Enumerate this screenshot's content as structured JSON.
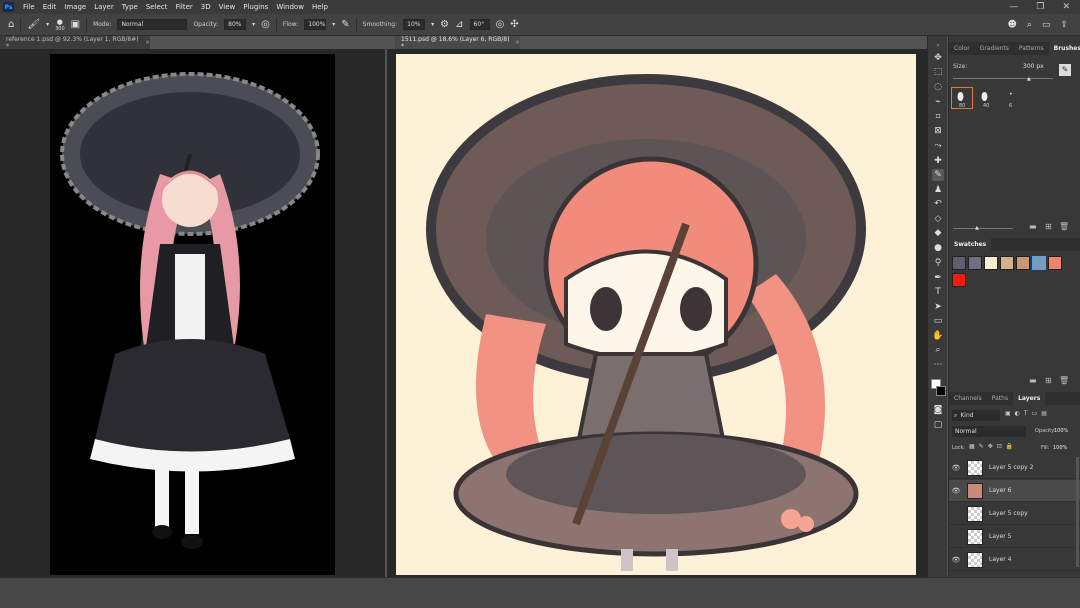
{
  "menubar": {
    "logo": "Ps",
    "items": [
      "File",
      "Edit",
      "Image",
      "Layer",
      "Type",
      "Select",
      "Filter",
      "3D",
      "View",
      "Plugins",
      "Window",
      "Help"
    ],
    "window_controls": [
      "—",
      "❐",
      "✕"
    ]
  },
  "options_bar": {
    "brush_size": "300",
    "mode_label": "Mode:",
    "mode_value": "Normal",
    "opacity_label": "Opacity:",
    "opacity_value": "80%",
    "flow_label": "Flow:",
    "flow_value": "100%",
    "smoothing_label": "Smoothing:",
    "smoothing_value": "10%",
    "angle_value": "60°"
  },
  "documents": [
    {
      "tab_label": "reference 1.psd @ 92.3% (Layer 1, RGB/8#) *"
    },
    {
      "tab_label": "1511.psd @ 18.6% (Layer 6, RGB/8) *"
    }
  ],
  "brushes_panel": {
    "tabs": [
      "Color",
      "Gradients",
      "Patterns",
      "Brushes"
    ],
    "active_tab": "Brushes",
    "size_label": "Size:",
    "size_value": "300 px",
    "presets": [
      {
        "num": "80"
      },
      {
        "num": "40"
      },
      {
        "num": "6"
      }
    ]
  },
  "swatches_panel": {
    "tab": "Swatches",
    "colors": [
      "#5d5f6e",
      "#6f6f80",
      "#f7ead0",
      "#d9b08c",
      "#c89878",
      "#78a0b4",
      "#f0846a",
      "#ee1c0e"
    ]
  },
  "layers_panel": {
    "tabs": [
      "Channels",
      "Paths",
      "Layers"
    ],
    "active_tab": "Layers",
    "filter_label": "Kind",
    "blend_mode": "Normal",
    "opacity_label": "Opacity:",
    "opacity_value": "100%",
    "lock_label": "Lock:",
    "fill_label": "Fill:",
    "fill_value": "100%",
    "layers": [
      {
        "name": "Layer 5 copy 2",
        "visible": true,
        "selected": false
      },
      {
        "name": "Layer 6",
        "visible": true,
        "selected": true
      },
      {
        "name": "Layer 5 copy",
        "visible": false,
        "selected": false
      },
      {
        "name": "Layer 5",
        "visible": false,
        "selected": false
      },
      {
        "name": "Layer 4",
        "visible": true,
        "selected": false
      }
    ]
  },
  "colors": {
    "foreground": "#000000",
    "background": "#ffffff",
    "accent": "#e07a3c"
  }
}
